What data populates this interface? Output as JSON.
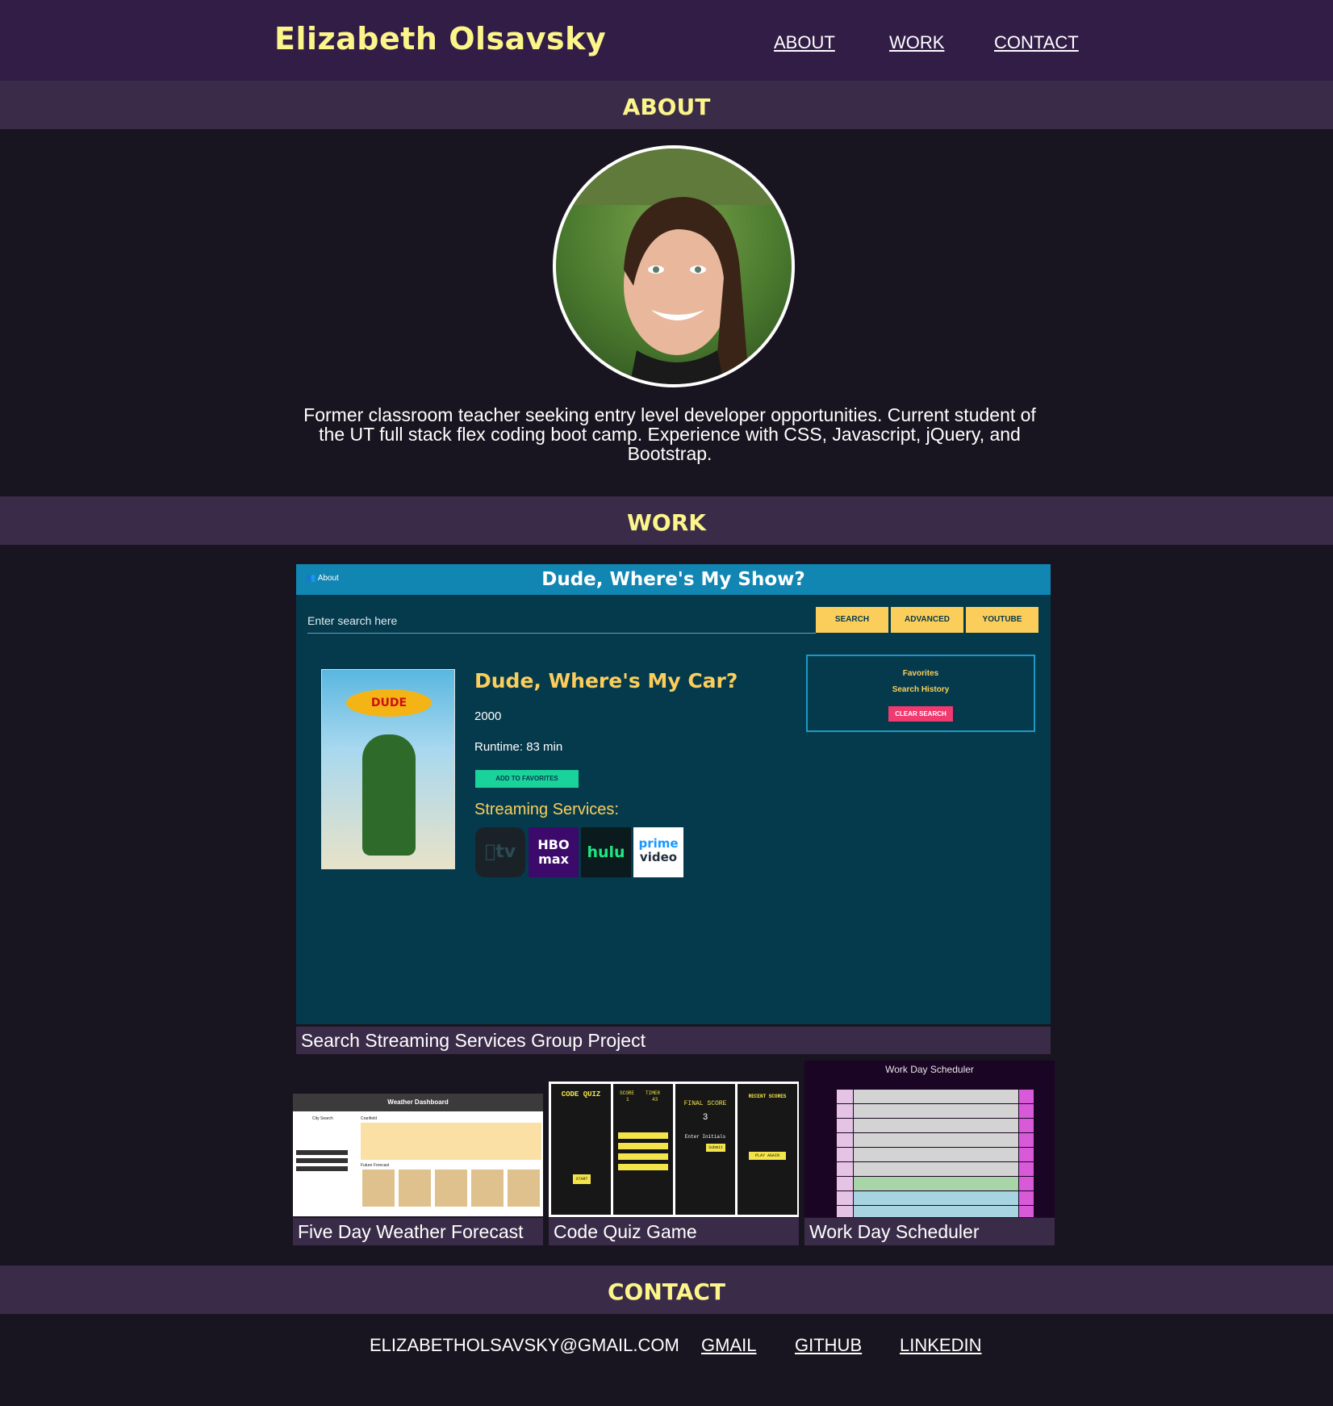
{
  "header": {
    "name": "Elizabeth Olsavsky",
    "nav": [
      "ABOUT",
      "WORK",
      "CONTACT"
    ]
  },
  "about": {
    "heading": "ABOUT",
    "bio": "Former classroom teacher seeking entry level developer opportunities. Current student of the UT full stack flex coding boot camp. Experience with CSS, Javascript, jQuery, and Bootstrap."
  },
  "work": {
    "heading": "WORK",
    "main_project": {
      "caption": "Search Streaming Services Group Project",
      "screenshot": {
        "about_link": "About",
        "app_title": "Dude, Where's My Show?",
        "search_placeholder": "Enter search here",
        "buttons": [
          "SEARCH",
          "ADVANCED",
          "YOUTUBE"
        ],
        "movie_title": "Dude, Where's My Car?",
        "year": "2000",
        "runtime": "Runtime: 83 min",
        "add_favorites": "ADD TO FAVORITES",
        "streaming_label": "Streaming Services:",
        "services": {
          "apple": "tv",
          "hbo": "HBO max",
          "hulu": "hulu",
          "prime_top": "prime",
          "prime_bottom": "video"
        },
        "poster_logo": "DUDE",
        "favorites": "Favorites",
        "search_history": "Search History",
        "clear_search": "CLEAR SEARCH"
      }
    },
    "projects": [
      {
        "caption": "Five Day Weather Forecast",
        "screenshot_title": "Weather Dashboard",
        "city_search_label": "City Search",
        "current_label": "Cranfield",
        "future_label": "Future Forecast"
      },
      {
        "caption": "Code Quiz Game",
        "quiz_title": "CODE QUIZ",
        "score_label": "SCORE",
        "timer_label": "TIMER",
        "score_value": "1",
        "timer_value": "43",
        "final_score_label": "FINAL SCORE",
        "final_score_value": "3",
        "enter_initials": "Enter Initials",
        "submit": "Submit",
        "recent_scores": "RECENT SCORES",
        "play_again": "PLAY AGAIN",
        "start": "START"
      },
      {
        "caption": "Work Day Scheduler",
        "screenshot_title": "Work Day Scheduler"
      }
    ]
  },
  "contact": {
    "heading": "CONTACT",
    "items": [
      "ELIZABETHOLSAVSKY@GMAIL.COM",
      "GMAIL",
      "GITHUB",
      "LINKEDIN"
    ]
  },
  "colors": {
    "header_bg": "#321d47",
    "section_bar_bg": "#3a2c48",
    "page_bg": "#191520",
    "accent_yellow": "#fcf58a"
  }
}
